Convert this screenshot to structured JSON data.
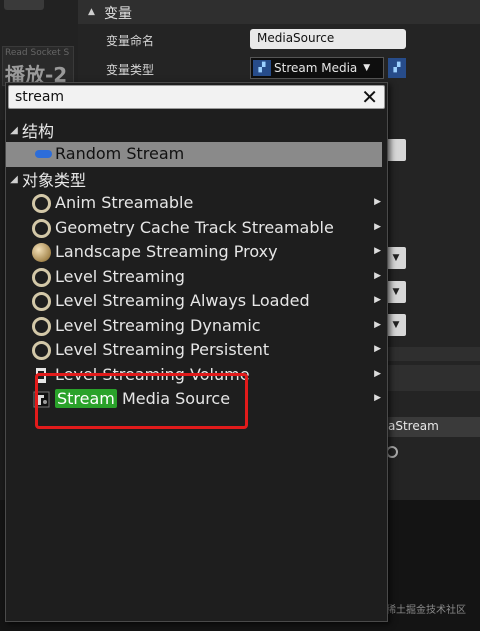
{
  "details": {
    "section_title": "变量",
    "var_name_label": "变量命名",
    "var_name_value": "MediaSource",
    "var_type_label": "变量类型",
    "var_type_value": "Stream Media",
    "partial_stream_text": "aStream"
  },
  "thumbnail": {
    "caption": "Read Socket S",
    "big_text": "播放-2"
  },
  "popup": {
    "search_value": "stream",
    "clear_icon": "close-icon",
    "categories": {
      "structure": "结构",
      "object_types": "对象类型"
    },
    "struct_items": [
      {
        "label": "Random Stream",
        "icon": "struct-pill-icon"
      }
    ],
    "object_items": [
      {
        "label": "Anim Streamable",
        "icon": "class-ring-icon"
      },
      {
        "label": "Geometry Cache Track Streamable",
        "icon": "class-ring-icon"
      },
      {
        "label": "Landscape Streaming Proxy",
        "icon": "actor-sphere-icon"
      },
      {
        "label": "Level Streaming",
        "icon": "class-ring-icon"
      },
      {
        "label": "Level Streaming Always Loaded",
        "icon": "class-ring-icon"
      },
      {
        "label": "Level Streaming Dynamic",
        "icon": "class-ring-icon"
      },
      {
        "label": "Level Streaming Persistent",
        "icon": "class-ring-icon"
      },
      {
        "label": "Level Streaming Volume",
        "icon": "volume-icon"
      },
      {
        "label_highlight": "Stream",
        "label_rest": " Media Source",
        "icon": "media-source-icon"
      }
    ]
  },
  "watermark": "@稀土掘金技术社区",
  "colors": {
    "match_highlight": "#2aa22a",
    "annotation_box": "#e21b1b",
    "selected_row": "#8a8a8a",
    "struct_icon": "#2d6dd9"
  }
}
